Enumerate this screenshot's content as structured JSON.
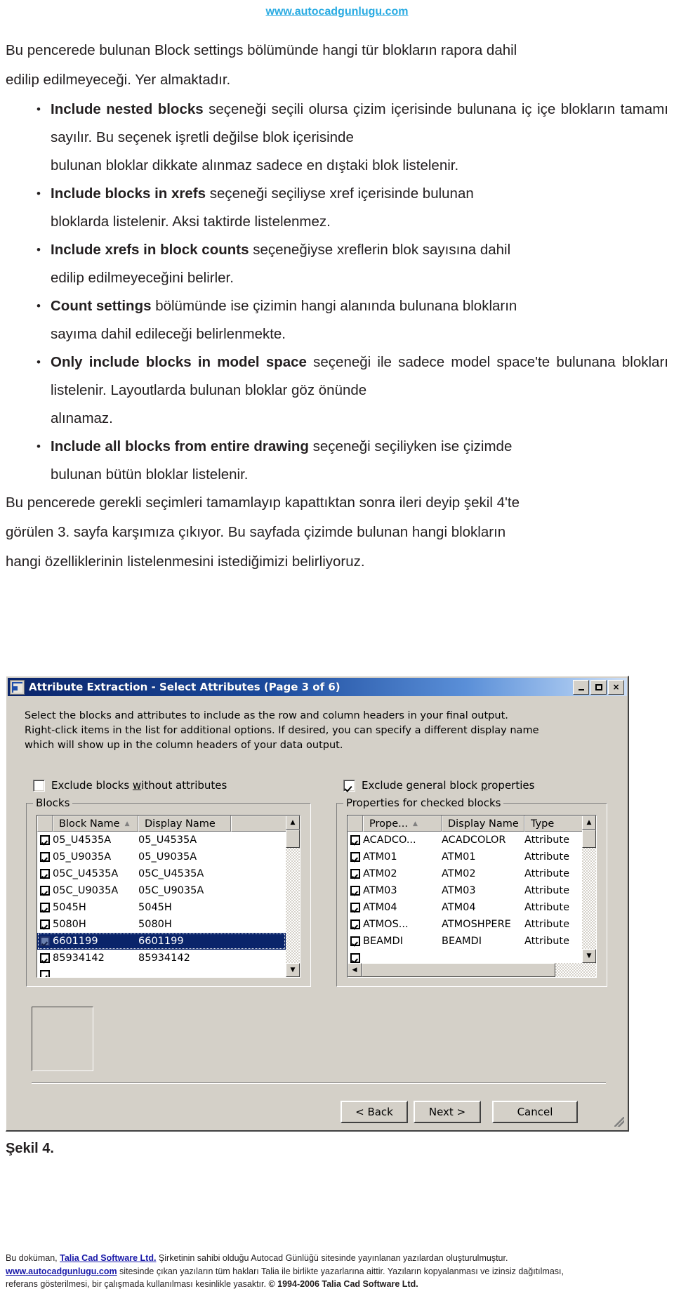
{
  "page": {
    "site_link": "www.autocadgunlugu.com",
    "intro": {
      "line1": "Bu pencerede bulunan Block settings bölümünde hangi tür blokların rapora dahil",
      "line2": "edilip edilmeyeceği. Yer almaktadır."
    },
    "bullets": [
      {
        "term": "Include nested blocks",
        "rest": " seçeneği seçili olursa çizim içerisinde bulunana iç içe blokların tamamı sayılır. Bu seçenek işretli değilse blok içerisinde",
        "last": "bulunan bloklar dikkate alınmaz sadece en dıştaki blok listelenir."
      },
      {
        "term": "Include blocks in xrefs",
        "rest": " seçeneği seçiliyse xref içerisinde bulunan",
        "last": "bloklarda listelenir. Aksi taktirde listelenmez."
      },
      {
        "term": "Include xrefs in block counts",
        "rest": " seçeneğiyse xreflerin blok sayısına dahil",
        "last": "edilip edilmeyeceğini belirler."
      },
      {
        "term": "Count settings",
        "rest": " bölümünde ise çizimin hangi alanında bulunana blokların",
        "last": "sayıma dahil edileceği belirlenmekte."
      },
      {
        "term": "Only include blocks in model space",
        "rest": " seçeneği ile sadece model space'te bulunana blokları listelenir. Layoutlarda bulunan bloklar göz önünde",
        "last": "alınamaz."
      },
      {
        "term": "Include all blocks from entire drawing",
        "rest": " seçeneği seçiliyken ise çizimde",
        "last": "bulunan bütün bloklar listelenir."
      }
    ],
    "outro": {
      "line1": "Bu pencerede gerekli seçimleri tamamlayıp kapattıktan sonra ileri deyip şekil 4'te",
      "line2": "görülen 3. sayfa karşımıza çıkıyor. Bu sayfada çizimde bulunan hangi blokların",
      "line3": "hangi özelliklerinin listelenmesini istediğimizi belirliyoruz."
    },
    "figure_caption": "Şekil 4."
  },
  "dialog": {
    "title": "Attribute Extraction - Select Attributes (Page 3 of 6)",
    "window_icon": "attribute-extraction-icon",
    "titlebar_buttons": {
      "minimize": "minimize-icon",
      "maximize": "maximize-icon",
      "close": "×"
    },
    "instructions": [
      "Select the blocks and attributes to include as the row and column headers in your final output.",
      "Right-click items in the list for additional options. If desired, you can specify a different display name",
      "which will show up in the column headers of your data output."
    ],
    "left": {
      "checkbox_label": "Exclude blocks without attributes",
      "checkbox_checked": false,
      "group_label": "Blocks",
      "columns": [
        "Block Name",
        "Display Name"
      ],
      "sorted_column": 0,
      "sort_arrow": "▲",
      "rows": [
        {
          "checked": true,
          "block_name": "05_U4535A",
          "display_name": "05_U4535A",
          "selected": false
        },
        {
          "checked": true,
          "block_name": "05_U9035A",
          "display_name": "05_U9035A",
          "selected": false
        },
        {
          "checked": true,
          "block_name": "05C_U4535A",
          "display_name": "05C_U4535A",
          "selected": false
        },
        {
          "checked": true,
          "block_name": "05C_U9035A",
          "display_name": "05C_U9035A",
          "selected": false
        },
        {
          "checked": true,
          "block_name": "5045H",
          "display_name": "5045H",
          "selected": false
        },
        {
          "checked": true,
          "block_name": "5080H",
          "display_name": "5080H",
          "selected": false
        },
        {
          "checked": true,
          "block_name": "6601199",
          "display_name": "6601199",
          "selected": true
        },
        {
          "checked": true,
          "block_name": "85934142",
          "display_name": "85934142",
          "selected": false
        }
      ],
      "scroll_up": "▲",
      "scroll_down": "▼"
    },
    "right": {
      "checkbox_label": "Exclude general block properties",
      "checkbox_checked": true,
      "group_label": "Properties for checked blocks",
      "columns": [
        "Prope...",
        "Display Name",
        "Type"
      ],
      "sorted_column": 0,
      "sort_arrow": "▲",
      "rows": [
        {
          "checked": true,
          "property": "ACADCO...",
          "display_name": "ACADCOLOR",
          "type": "Attribute"
        },
        {
          "checked": true,
          "property": "ATM01",
          "display_name": "ATM01",
          "type": "Attribute"
        },
        {
          "checked": true,
          "property": "ATM02",
          "display_name": "ATM02",
          "type": "Attribute"
        },
        {
          "checked": true,
          "property": "ATM03",
          "display_name": "ATM03",
          "type": "Attribute"
        },
        {
          "checked": true,
          "property": "ATM04",
          "display_name": "ATM04",
          "type": "Attribute"
        },
        {
          "checked": true,
          "property": "ATMOS...",
          "display_name": "ATMOSHPERE",
          "type": "Attribute"
        },
        {
          "checked": true,
          "property": "BEAMDI",
          "display_name": "BEAMDI",
          "type": "Attribute"
        }
      ],
      "scroll_up": "▲",
      "scroll_down": "▼",
      "scroll_left": "◀",
      "scroll_right": "▶"
    },
    "buttons": {
      "back": "< Back",
      "next": "Next >",
      "cancel": "Cancel"
    }
  },
  "footer": {
    "l1_a": "Bu doküman, ",
    "l1_link": "Talia Cad Software Ltd.",
    "l1_b": " Şirketinin sahibi olduğu  Autocad Günlüğü sitesinde yayınlanan yazılardan oluşturulmuştur.",
    "l2_link": "www.autocadgunlugu.com",
    "l2_b": " sitesinde çıkan yazıların tüm hakları Talia ile birlikte yazarlarına aittir. Yazıların kopyalanması ve izinsiz dağıtılması,",
    "l3_a": "referans gösterilmesi, bir çalışmada kullanılması kesinlikle yasaktır. ",
    "l3_bold": "© 1994-2006 Talia Cad Software Ltd."
  },
  "colors": {
    "link": "#29ABE2",
    "dialog_face": "#d4d0c8",
    "titlebar_start": "#0a246a",
    "selection": "#0a246a",
    "footer_link": "#1a1aa8"
  }
}
